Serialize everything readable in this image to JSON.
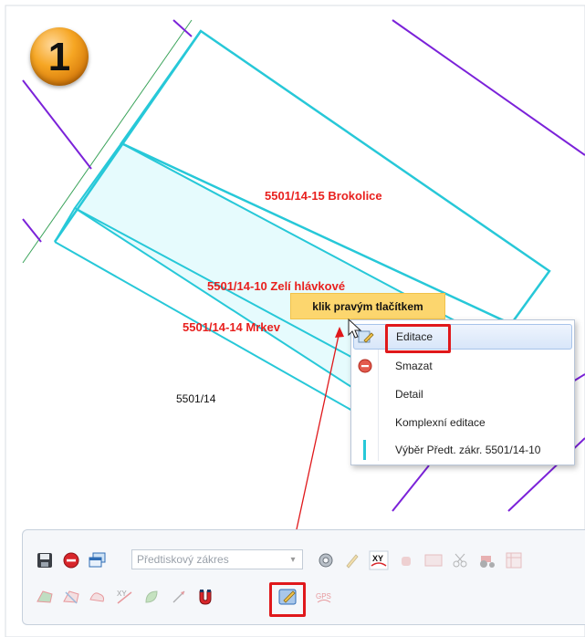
{
  "step_badge": {
    "number": "1"
  },
  "map": {
    "labels": {
      "brokolice": "5501/14-15 Brokolice",
      "zeli": "5501/14-10 Zelí hlávkové",
      "mrkev": "5501/14-14 Mrkev",
      "parcel": "5501/14"
    },
    "colors": {
      "parcel_border": "#27c8d8",
      "parcel_fill": "#e6fbfd",
      "boundary": "#7b22d9",
      "label": "#e8201e"
    }
  },
  "tooltip": {
    "text": "klik pravým tlačítkem"
  },
  "context_menu": {
    "items": [
      {
        "label": "Editace",
        "icon": "edit-pencil-icon",
        "state": "hover"
      },
      {
        "label": "Smazat",
        "icon": "delete-icon"
      },
      {
        "label": "Detail",
        "icon": ""
      },
      {
        "label": "Komplexní editace",
        "icon": ""
      },
      {
        "label": "Výběr Předt. zákr. 5501/14-10",
        "icon": "select-bar-icon"
      }
    ]
  },
  "toolbar": {
    "layer_select": {
      "placeholder": "Předtiskový zákres"
    },
    "buttons_row1": [
      "save-icon",
      "stop-icon",
      "windows-icon",
      "settings-icon",
      "pencil-icon",
      "xy-icon",
      "hand-icon",
      "map-icon",
      "scissors-icon",
      "tractor-icon",
      "table-icon"
    ],
    "buttons_row2": [
      "polygon-icon",
      "split-icon",
      "merge-icon",
      "xy-edit-icon",
      "leaf-icon",
      "measure-icon",
      "magnet-icon",
      "edit-tool-icon",
      "gps-icon"
    ],
    "gps_label": "GPS",
    "xy_label": "XY"
  },
  "highlight_color": "#e0181b"
}
